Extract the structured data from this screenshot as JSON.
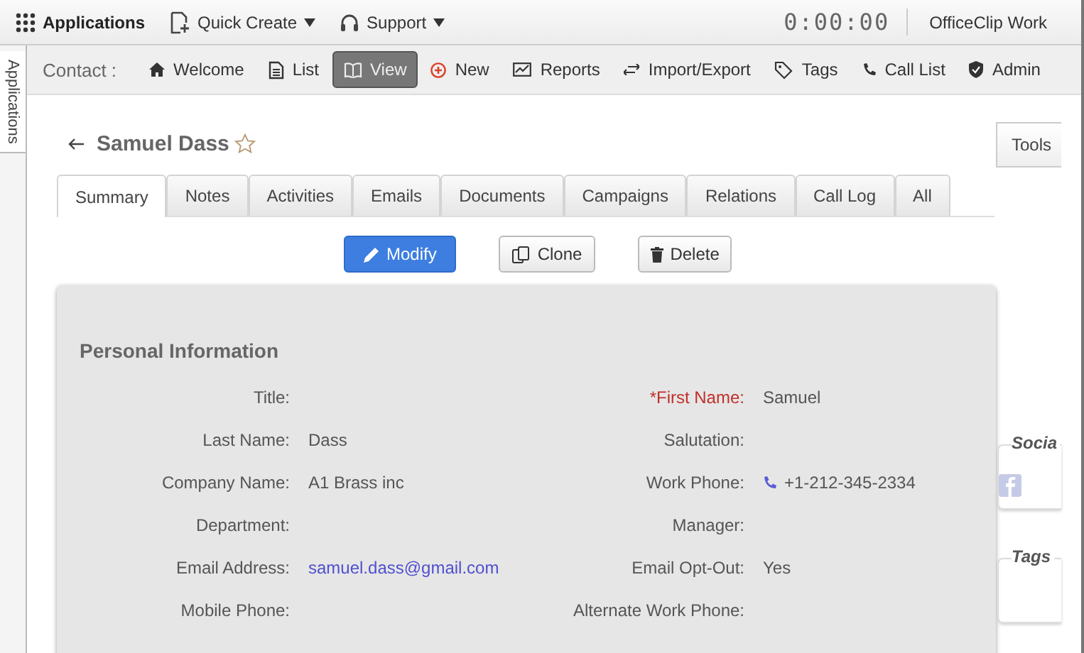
{
  "top_bar": {
    "apps_label": "Applications",
    "menus": [
      {
        "label": "Quick Create"
      },
      {
        "label": "Support"
      }
    ],
    "timer": "0:00:00",
    "product": "OfficeClip Work"
  },
  "side_tab": {
    "label": "Applications"
  },
  "nav": {
    "section": "Contact :",
    "items": [
      {
        "label": "Welcome",
        "selected": false
      },
      {
        "label": "List",
        "selected": false
      },
      {
        "label": "View",
        "selected": true
      },
      {
        "label": "New",
        "selected": false
      },
      {
        "label": "Reports",
        "selected": false
      },
      {
        "label": "Import/Export",
        "selected": false
      },
      {
        "label": "Tags",
        "selected": false
      },
      {
        "label": "Call List",
        "selected": false
      },
      {
        "label": "Admin",
        "selected": false
      }
    ]
  },
  "contact": {
    "name": "Samuel Dass",
    "starred": false
  },
  "tabs": [
    {
      "label": "Summary",
      "selected": true
    },
    {
      "label": "Notes",
      "selected": false
    },
    {
      "label": "Activities",
      "selected": false
    },
    {
      "label": "Emails",
      "selected": false
    },
    {
      "label": "Documents",
      "selected": false
    },
    {
      "label": "Campaigns",
      "selected": false
    },
    {
      "label": "Relations",
      "selected": false
    },
    {
      "label": "Call Log",
      "selected": false
    },
    {
      "label": "All",
      "selected": false
    }
  ],
  "actions": [
    {
      "label": "Modify",
      "kind": "primary"
    },
    {
      "label": "Clone",
      "kind": "default"
    },
    {
      "label": "Delete",
      "kind": "default"
    }
  ],
  "personal_information": {
    "title": "Personal Information",
    "rows": [
      [
        {
          "label": "Title:",
          "required": false
        },
        {
          "label": "*First Name:",
          "value": "Samuel",
          "kind": "text",
          "required": true
        }
      ],
      [
        {
          "label": "Last Name:",
          "value": "Dass",
          "kind": "text",
          "required": false
        },
        {
          "label": "Salutation:",
          "required": false
        }
      ],
      [
        {
          "label": "Company Name:",
          "value": "A1 Brass inc",
          "kind": "text",
          "required": false
        },
        {
          "label": "Work Phone:",
          "value": "+1-212-345-2334",
          "kind": "phone",
          "required": false
        }
      ],
      [
        {
          "label": "Department:",
          "required": false
        },
        {
          "label": "Manager:",
          "required": false
        }
      ],
      [
        {
          "label": "Email Address:",
          "value": "samuel.dass@gmail.com",
          "kind": "email",
          "required": false
        },
        {
          "label": "Email Opt-Out:",
          "value": "Yes",
          "kind": "text",
          "required": false
        }
      ],
      [
        {
          "label": "Mobile Phone:",
          "required": false
        },
        {
          "label": "Alternate Work Phone:",
          "required": false
        }
      ]
    ]
  },
  "right_panel": {
    "tools_button": "Tools",
    "social_title": "Socia",
    "tags_title": "Tags"
  }
}
